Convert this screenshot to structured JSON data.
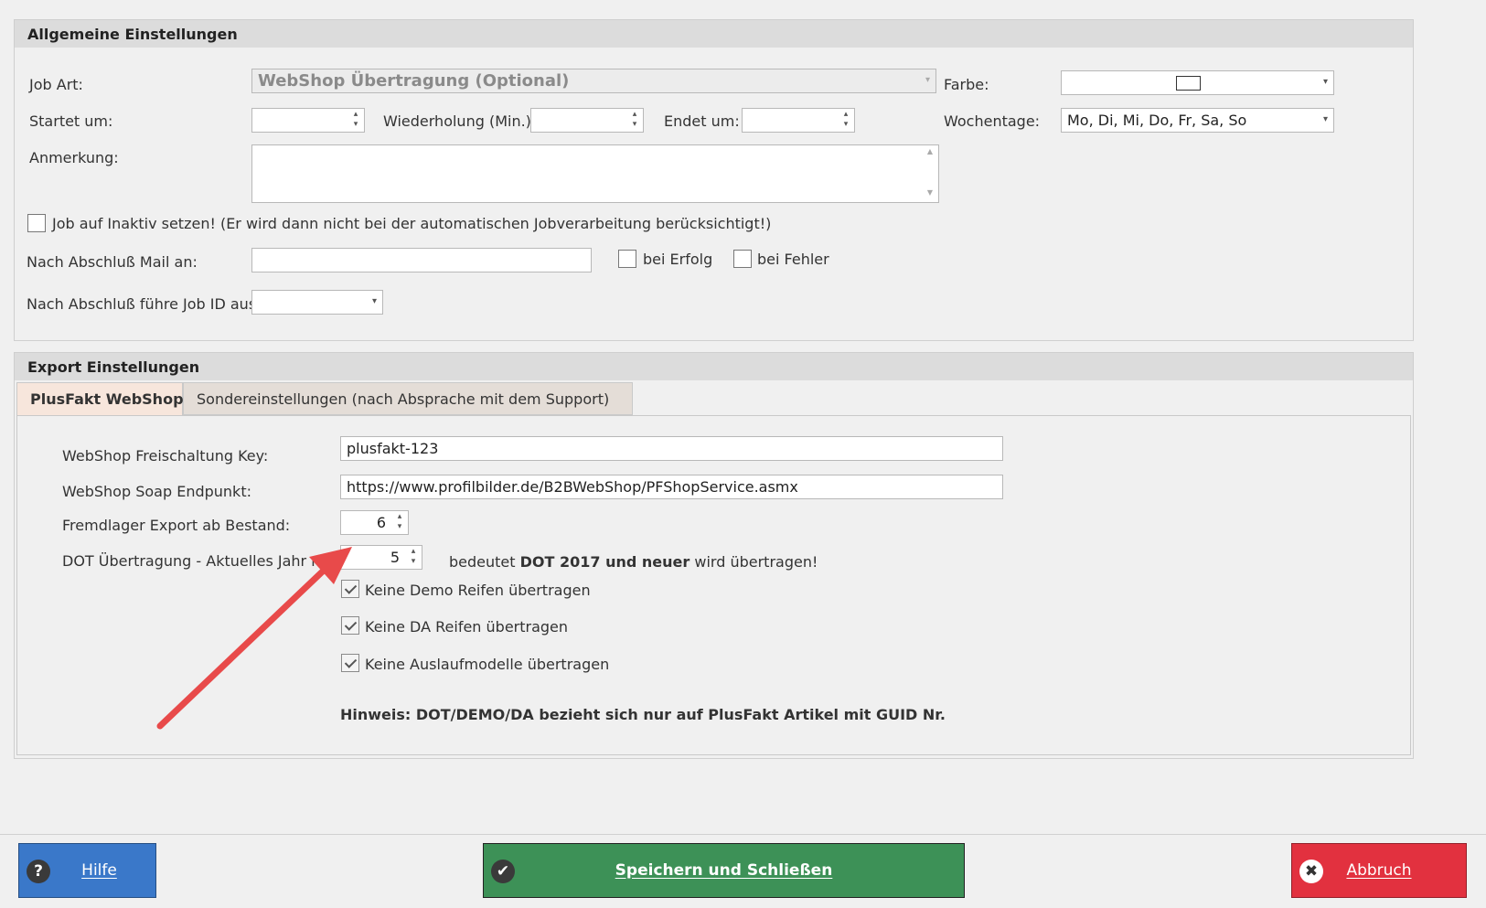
{
  "general": {
    "title": "Allgemeine Einstellungen",
    "job_art_label": "Job Art:",
    "job_art_value": "WebShop Übertragung (Optional)",
    "farbe_label": "Farbe:",
    "startet_label": "Startet um:",
    "startet_value": "",
    "wiederholung_label": "Wiederholung (Min.):",
    "wiederholung_value": "",
    "endet_label": "Endet um:",
    "endet_value": "",
    "wochentage_label": "Wochentage:",
    "wochentage_value": "Mo, Di, Mi, Do, Fr, Sa, So",
    "anmerkung_label": "Anmerkung:",
    "anmerkung_value": "",
    "inaktiv_label": "Job auf Inaktiv setzen! (Er wird dann nicht bei der automatischen Jobverarbeitung berücksichtigt!)",
    "inaktiv_checked": false,
    "mail_label": "Nach Abschluß Mail an:",
    "mail_value": "",
    "bei_erfolg_label": "bei Erfolg",
    "bei_fehler_label": "bei Fehler",
    "job_id_label": "Nach Abschluß führe Job ID aus:",
    "job_id_value": ""
  },
  "export": {
    "title": "Export Einstellungen",
    "tabs": [
      {
        "label": "PlusFakt WebShop",
        "active": true
      },
      {
        "label": "Sondereinstellungen (nach Absprache mit dem Support)",
        "active": false
      }
    ],
    "key_label": "WebShop Freischaltung Key:",
    "key_value": "plusfakt-123",
    "soap_label": "WebShop Soap Endpunkt:",
    "soap_value": "https://www.profilbilder.de/B2BWebShop/PFShopService.asmx",
    "fremdlager_label": "Fremdlager Export ab Bestand:",
    "fremdlager_value": "6",
    "dot_label": "DOT Übertragung - Aktuelles Jahr minus:",
    "dot_value": "5",
    "dot_hint_prefix": "bedeutet",
    "dot_hint_bold": "DOT 2017 und neuer",
    "dot_hint_suffix": "wird übertragen!",
    "no_demo_label": "Keine Demo Reifen übertragen",
    "no_da_label": "Keine DA Reifen übertragen",
    "no_auslauf_label": "Keine Auslaufmodelle übertragen",
    "hinweis": "Hinweis: DOT/DEMO/DA bezieht sich nur auf PlusFakt Artikel mit GUID Nr."
  },
  "footer": {
    "help_label": "Hilfe",
    "save_label": "Speichern und Schließen",
    "cancel_label": "Abbruch"
  },
  "colors": {
    "help": "#3a78c9",
    "save": "#3d9157",
    "cancel": "#e2313f",
    "arrow": "#e84a4a"
  }
}
